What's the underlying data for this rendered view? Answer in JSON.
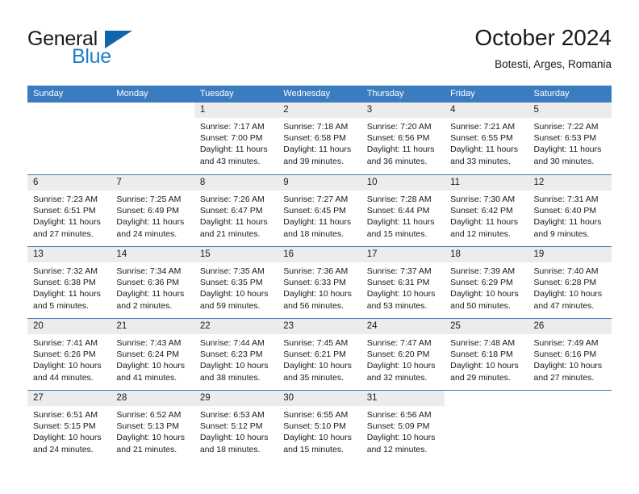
{
  "brand": {
    "word1": "General",
    "word2": "Blue",
    "flag_icon": "triangle-flag-icon",
    "color_dark": "#1a1a1a",
    "color_blue": "#1d7dc4",
    "flag_color": "#1166ab"
  },
  "header": {
    "title": "October 2024",
    "subtitle": "Botesti, Arges, Romania"
  },
  "calendar": {
    "header_bg": "#3a7cc0",
    "header_text": "#ffffff",
    "daynum_bg": "#ececec",
    "weekdays": [
      "Sunday",
      "Monday",
      "Tuesday",
      "Wednesday",
      "Thursday",
      "Friday",
      "Saturday"
    ],
    "weeks": [
      [
        {
          "blank": true
        },
        {
          "blank": true
        },
        {
          "day": "1",
          "sunrise": "Sunrise: 7:17 AM",
          "sunset": "Sunset: 7:00 PM",
          "daylight": "Daylight: 11 hours and 43 minutes."
        },
        {
          "day": "2",
          "sunrise": "Sunrise: 7:18 AM",
          "sunset": "Sunset: 6:58 PM",
          "daylight": "Daylight: 11 hours and 39 minutes."
        },
        {
          "day": "3",
          "sunrise": "Sunrise: 7:20 AM",
          "sunset": "Sunset: 6:56 PM",
          "daylight": "Daylight: 11 hours and 36 minutes."
        },
        {
          "day": "4",
          "sunrise": "Sunrise: 7:21 AM",
          "sunset": "Sunset: 6:55 PM",
          "daylight": "Daylight: 11 hours and 33 minutes."
        },
        {
          "day": "5",
          "sunrise": "Sunrise: 7:22 AM",
          "sunset": "Sunset: 6:53 PM",
          "daylight": "Daylight: 11 hours and 30 minutes."
        }
      ],
      [
        {
          "day": "6",
          "sunrise": "Sunrise: 7:23 AM",
          "sunset": "Sunset: 6:51 PM",
          "daylight": "Daylight: 11 hours and 27 minutes."
        },
        {
          "day": "7",
          "sunrise": "Sunrise: 7:25 AM",
          "sunset": "Sunset: 6:49 PM",
          "daylight": "Daylight: 11 hours and 24 minutes."
        },
        {
          "day": "8",
          "sunrise": "Sunrise: 7:26 AM",
          "sunset": "Sunset: 6:47 PM",
          "daylight": "Daylight: 11 hours and 21 minutes."
        },
        {
          "day": "9",
          "sunrise": "Sunrise: 7:27 AM",
          "sunset": "Sunset: 6:45 PM",
          "daylight": "Daylight: 11 hours and 18 minutes."
        },
        {
          "day": "10",
          "sunrise": "Sunrise: 7:28 AM",
          "sunset": "Sunset: 6:44 PM",
          "daylight": "Daylight: 11 hours and 15 minutes."
        },
        {
          "day": "11",
          "sunrise": "Sunrise: 7:30 AM",
          "sunset": "Sunset: 6:42 PM",
          "daylight": "Daylight: 11 hours and 12 minutes."
        },
        {
          "day": "12",
          "sunrise": "Sunrise: 7:31 AM",
          "sunset": "Sunset: 6:40 PM",
          "daylight": "Daylight: 11 hours and 9 minutes."
        }
      ],
      [
        {
          "day": "13",
          "sunrise": "Sunrise: 7:32 AM",
          "sunset": "Sunset: 6:38 PM",
          "daylight": "Daylight: 11 hours and 5 minutes."
        },
        {
          "day": "14",
          "sunrise": "Sunrise: 7:34 AM",
          "sunset": "Sunset: 6:36 PM",
          "daylight": "Daylight: 11 hours and 2 minutes."
        },
        {
          "day": "15",
          "sunrise": "Sunrise: 7:35 AM",
          "sunset": "Sunset: 6:35 PM",
          "daylight": "Daylight: 10 hours and 59 minutes."
        },
        {
          "day": "16",
          "sunrise": "Sunrise: 7:36 AM",
          "sunset": "Sunset: 6:33 PM",
          "daylight": "Daylight: 10 hours and 56 minutes."
        },
        {
          "day": "17",
          "sunrise": "Sunrise: 7:37 AM",
          "sunset": "Sunset: 6:31 PM",
          "daylight": "Daylight: 10 hours and 53 minutes."
        },
        {
          "day": "18",
          "sunrise": "Sunrise: 7:39 AM",
          "sunset": "Sunset: 6:29 PM",
          "daylight": "Daylight: 10 hours and 50 minutes."
        },
        {
          "day": "19",
          "sunrise": "Sunrise: 7:40 AM",
          "sunset": "Sunset: 6:28 PM",
          "daylight": "Daylight: 10 hours and 47 minutes."
        }
      ],
      [
        {
          "day": "20",
          "sunrise": "Sunrise: 7:41 AM",
          "sunset": "Sunset: 6:26 PM",
          "daylight": "Daylight: 10 hours and 44 minutes."
        },
        {
          "day": "21",
          "sunrise": "Sunrise: 7:43 AM",
          "sunset": "Sunset: 6:24 PM",
          "daylight": "Daylight: 10 hours and 41 minutes."
        },
        {
          "day": "22",
          "sunrise": "Sunrise: 7:44 AM",
          "sunset": "Sunset: 6:23 PM",
          "daylight": "Daylight: 10 hours and 38 minutes."
        },
        {
          "day": "23",
          "sunrise": "Sunrise: 7:45 AM",
          "sunset": "Sunset: 6:21 PM",
          "daylight": "Daylight: 10 hours and 35 minutes."
        },
        {
          "day": "24",
          "sunrise": "Sunrise: 7:47 AM",
          "sunset": "Sunset: 6:20 PM",
          "daylight": "Daylight: 10 hours and 32 minutes."
        },
        {
          "day": "25",
          "sunrise": "Sunrise: 7:48 AM",
          "sunset": "Sunset: 6:18 PM",
          "daylight": "Daylight: 10 hours and 29 minutes."
        },
        {
          "day": "26",
          "sunrise": "Sunrise: 7:49 AM",
          "sunset": "Sunset: 6:16 PM",
          "daylight": "Daylight: 10 hours and 27 minutes."
        }
      ],
      [
        {
          "day": "27",
          "sunrise": "Sunrise: 6:51 AM",
          "sunset": "Sunset: 5:15 PM",
          "daylight": "Daylight: 10 hours and 24 minutes."
        },
        {
          "day": "28",
          "sunrise": "Sunrise: 6:52 AM",
          "sunset": "Sunset: 5:13 PM",
          "daylight": "Daylight: 10 hours and 21 minutes."
        },
        {
          "day": "29",
          "sunrise": "Sunrise: 6:53 AM",
          "sunset": "Sunset: 5:12 PM",
          "daylight": "Daylight: 10 hours and 18 minutes."
        },
        {
          "day": "30",
          "sunrise": "Sunrise: 6:55 AM",
          "sunset": "Sunset: 5:10 PM",
          "daylight": "Daylight: 10 hours and 15 minutes."
        },
        {
          "day": "31",
          "sunrise": "Sunrise: 6:56 AM",
          "sunset": "Sunset: 5:09 PM",
          "daylight": "Daylight: 10 hours and 12 minutes."
        },
        {
          "blank": true
        },
        {
          "blank": true
        }
      ]
    ]
  }
}
